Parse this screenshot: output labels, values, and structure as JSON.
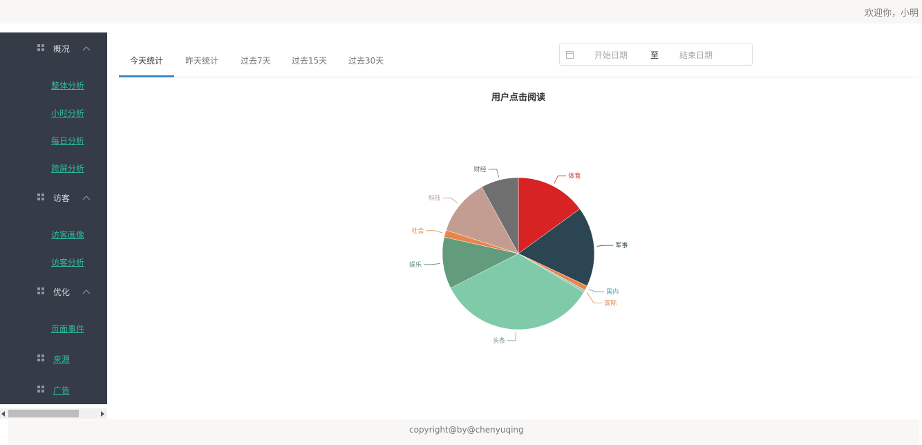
{
  "header": {
    "welcome": "欢迎你，小明"
  },
  "sidebar": {
    "groups": [
      {
        "label": "概况",
        "items": [
          "整体分析",
          "小时分析",
          "每日分析",
          "跨屏分析"
        ]
      },
      {
        "label": "访客",
        "items": [
          "访客画像",
          "访客分析"
        ]
      },
      {
        "label": "优化",
        "items": [
          "页面事件"
        ]
      }
    ],
    "links": [
      "来源",
      "广告"
    ]
  },
  "tabs": [
    {
      "label": "今天统计",
      "active": true
    },
    {
      "label": "昨天统计",
      "active": false
    },
    {
      "label": "过去7天",
      "active": false
    },
    {
      "label": "过去15天",
      "active": false
    },
    {
      "label": "过去30天",
      "active": false
    }
  ],
  "date_range": {
    "start_placeholder": "开始日期",
    "separator": "至",
    "end_placeholder": "结束日期"
  },
  "footer": {
    "copyright": "copyright@by@chenyuqing"
  },
  "chart_data": {
    "type": "pie",
    "title": "用户点击阅读",
    "slices": [
      {
        "name": "体育",
        "value": 15.0,
        "color": "#d82325"
      },
      {
        "name": "军事",
        "value": 17.0,
        "color": "#2c4552"
      },
      {
        "name": "国内",
        "value": 1.0,
        "color": "#e8854a"
      },
      {
        "name": "国际",
        "value": 0.5,
        "color": "#9fc7b8"
      },
      {
        "name": "头条",
        "value": 34.0,
        "color": "#7fcaa9"
      },
      {
        "name": "娱乐",
        "value": 11.0,
        "color": "#639c7d"
      },
      {
        "name": "社会",
        "value": 1.5,
        "color": "#e8854a"
      },
      {
        "name": "科技",
        "value": 12.0,
        "color": "#c49d92"
      },
      {
        "name": "财经",
        "value": 8.0,
        "color": "#6f6f6f"
      }
    ]
  }
}
